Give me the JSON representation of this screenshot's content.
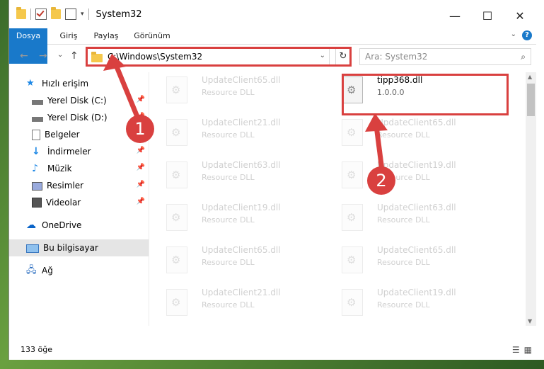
{
  "window": {
    "title": "System32",
    "controls": {
      "minimize": "—",
      "maximize": "☐",
      "close": "✕"
    }
  },
  "ribbon": {
    "tabs": [
      "Dosya",
      "Giriş",
      "Paylaş",
      "Görünüm"
    ],
    "help": "?"
  },
  "nav": {
    "back": "←",
    "forward": "→",
    "recent": "⌄",
    "up": "↑",
    "address": "C:\\Windows\\System32",
    "refresh": "↻"
  },
  "search": {
    "placeholder": "Ara: System32"
  },
  "sidebar": {
    "items": [
      {
        "label": "Hızlı erişim",
        "icon": "star-icon",
        "pinned": false
      },
      {
        "label": "Yerel Disk (C:)",
        "icon": "drive-icon",
        "pinned": true
      },
      {
        "label": "Yerel Disk (D:)",
        "icon": "drive-icon",
        "pinned": true
      },
      {
        "label": "Belgeler",
        "icon": "document-icon",
        "pinned": true
      },
      {
        "label": "İndirmeler",
        "icon": "download-icon",
        "pinned": true
      },
      {
        "label": "Müzik",
        "icon": "music-icon",
        "pinned": true
      },
      {
        "label": "Resimler",
        "icon": "pictures-icon",
        "pinned": true
      },
      {
        "label": "Videolar",
        "icon": "video-icon",
        "pinned": true
      },
      {
        "label": "OneDrive",
        "icon": "cloud-icon",
        "pinned": false
      },
      {
        "label": "Bu bilgisayar",
        "icon": "computer-icon",
        "pinned": false,
        "selected": true
      },
      {
        "label": "Ağ",
        "icon": "network-icon",
        "pinned": false
      }
    ]
  },
  "files": {
    "left": [
      {
        "name": "UpdateClient65.dll",
        "desc": "Resource DLL"
      },
      {
        "name": "UpdateClient21.dll",
        "desc": "Resource DLL"
      },
      {
        "name": "UpdateClient63.dll",
        "desc": "Resource DLL"
      },
      {
        "name": "UpdateClient19.dll",
        "desc": "Resource DLL"
      },
      {
        "name": "UpdateClient65.dll",
        "desc": "Resource DLL"
      },
      {
        "name": "UpdateClient21.dll",
        "desc": "Resource DLL"
      }
    ],
    "right": [
      {
        "name": "tipp368.dll",
        "desc": "1.0.0.0",
        "highlight": true
      },
      {
        "name": "UpdateClient65.dll",
        "desc": "Resource DLL"
      },
      {
        "name": "UpdateClient19.dll",
        "desc": "Resource DLL"
      },
      {
        "name": "UpdateClient63.dll",
        "desc": "Resource DLL"
      },
      {
        "name": "UpdateClient65.dll",
        "desc": "Resource DLL"
      },
      {
        "name": "UpdateClient19.dll",
        "desc": "Resource DLL"
      }
    ]
  },
  "status": {
    "count": "133 öğe"
  },
  "annotations": {
    "badge1": "1",
    "badge2": "2",
    "color": "#d9403f"
  }
}
